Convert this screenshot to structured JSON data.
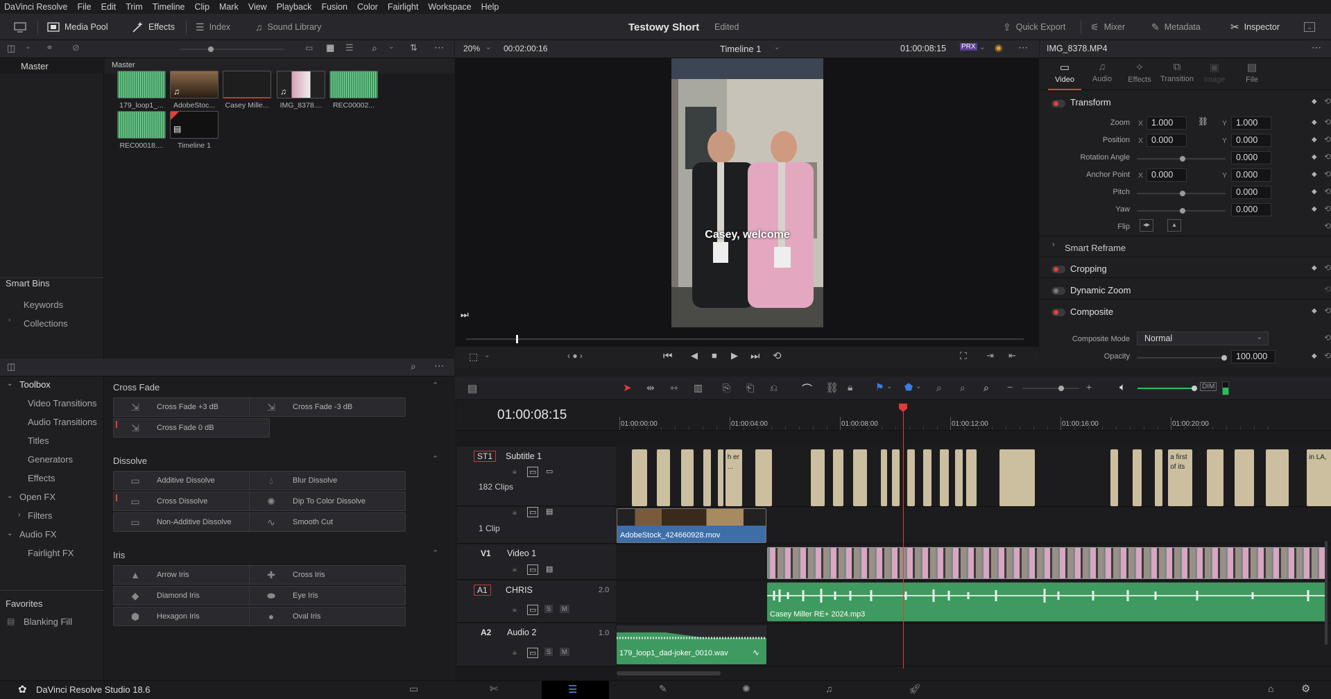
{
  "menu": {
    "items": [
      "DaVinci Resolve",
      "File",
      "Edit",
      "Trim",
      "Timeline",
      "Clip",
      "Mark",
      "View",
      "Playback",
      "Fusion",
      "Color",
      "Fairlight",
      "Workspace",
      "Help"
    ]
  },
  "toolbar": {
    "media_pool": "Media Pool",
    "effects": "Effects",
    "index": "Index",
    "sound_library": "Sound Library",
    "project_title": "Testowy Short",
    "project_status": "Edited",
    "quick_export": "Quick Export",
    "mixer": "Mixer",
    "metadata": "Metadata",
    "inspector": "Inspector"
  },
  "bins": {
    "master": "Master",
    "smart_bins": "Smart Bins",
    "keywords": "Keywords",
    "collections": "Collections"
  },
  "media_pool": {
    "header": "Master",
    "clips": [
      {
        "name": "179_loop1_...",
        "kind": "audio"
      },
      {
        "name": "AdobeStoc...",
        "kind": "video-audio"
      },
      {
        "name": "Casey Mille...",
        "kind": "dark"
      },
      {
        "name": "IMG_8378....",
        "kind": "video-audio"
      },
      {
        "name": "REC00002...",
        "kind": "audio"
      },
      {
        "name": "REC00018....",
        "kind": "audio"
      },
      {
        "name": "Timeline 1",
        "kind": "timeline"
      }
    ]
  },
  "viewer": {
    "zoom": "20%",
    "duration": "00:02:00:16",
    "timeline_name": "Timeline 1",
    "timecode": "01:00:08:15",
    "caption": "Casey, welcome",
    "scrub_progress": 0.09
  },
  "inspector": {
    "clip_name": "IMG_8378.MP4",
    "tabs": [
      "Video",
      "Audio",
      "Effects",
      "Transition",
      "Image",
      "File"
    ],
    "transform": "Transform",
    "zoom_label": "Zoom",
    "zoom_x": "1.000",
    "zoom_y": "1.000",
    "position_label": "Position",
    "position_x": "0.000",
    "position_y": "0.000",
    "rotation_label": "Rotation Angle",
    "rotation": "0.000",
    "anchor_label": "Anchor Point",
    "anchor_x": "0.000",
    "anchor_y": "0.000",
    "pitch_label": "Pitch",
    "pitch": "0.000",
    "yaw_label": "Yaw",
    "yaw": "0.000",
    "flip_label": "Flip",
    "x": "X",
    "y": "Y",
    "smart_reframe": "Smart Reframe",
    "cropping": "Cropping",
    "dynamic_zoom": "Dynamic Zoom",
    "composite": "Composite",
    "composite_mode_label": "Composite Mode",
    "composite_mode": "Normal",
    "opacity_label": "Opacity",
    "opacity": "100.000"
  },
  "toolbox": {
    "tree": [
      {
        "label": "Toolbox",
        "level": 0,
        "chevron": "down"
      },
      {
        "label": "Video Transitions",
        "level": 1
      },
      {
        "label": "Audio Transitions",
        "level": 1
      },
      {
        "label": "Titles",
        "level": 1
      },
      {
        "label": "Generators",
        "level": 1
      },
      {
        "label": "Effects",
        "level": 1
      },
      {
        "label": "Open FX",
        "level": 0,
        "chevron": "down"
      },
      {
        "label": "Filters",
        "level": 1,
        "chevron": "right"
      },
      {
        "label": "Audio FX",
        "level": 0,
        "chevron": "down"
      },
      {
        "label": "Fairlight FX",
        "level": 1
      }
    ],
    "favorites": "Favorites",
    "favorite_item": "Blanking Fill"
  },
  "effects_library": {
    "categories": [
      {
        "name": "Cross Fade",
        "items": [
          "Cross Fade +3 dB",
          "Cross Fade -3 dB",
          "Cross Fade 0 dB"
        ]
      },
      {
        "name": "Dissolve",
        "items": [
          "Additive Dissolve",
          "Blur Dissolve",
          "Cross Dissolve",
          "Dip To Color Dissolve",
          "Non-Additive Dissolve",
          "Smooth Cut"
        ]
      },
      {
        "name": "Iris",
        "items": [
          "Arrow Iris",
          "Cross Iris",
          "Diamond Iris",
          "Eye Iris",
          "Hexagon Iris",
          "Oval Iris"
        ]
      }
    ]
  },
  "timeline": {
    "timecode": "01:00:08:15",
    "ruler": [
      "01:00:00:00",
      "01:00:04:00",
      "01:00:08:00",
      "01:00:12:00",
      "01:00:16:00",
      "01:00:20:00"
    ],
    "tracks": {
      "st1": {
        "id": "ST1",
        "name": "Subtitle 1",
        "clips": "182 Clips"
      },
      "v2": {
        "clips": "1 Clip",
        "clip_name": "AdobeStock_424660928.mov"
      },
      "v1": {
        "id": "V1",
        "name": "Video 1"
      },
      "a1": {
        "id": "A1",
        "name": "CHRIS",
        "channels": "2.0",
        "clip_name": "Casey Miller RE+ 2024.mp3"
      },
      "a2": {
        "id": "A2",
        "name": "Audio 2",
        "channels": "1.0",
        "clip_name": "179_loop1_dad-joker_0010.wav"
      }
    },
    "subtitles": [
      {
        "text": ""
      },
      {
        "text": ""
      },
      {
        "text": ""
      },
      {
        "text": ""
      },
      {
        "text": ""
      },
      {
        "text": "h er ..."
      },
      {
        "text": ""
      },
      {
        "text": ""
      },
      {
        "text": ""
      },
      {
        "text": ""
      },
      {
        "text": ""
      },
      {
        "text": ""
      },
      {
        "text": ""
      },
      {
        "text": ""
      },
      {
        "text": ""
      },
      {
        "text": ""
      },
      {
        "text": ""
      },
      {
        "text": ""
      },
      {
        "text": ""
      },
      {
        "text": ""
      },
      {
        "text": ""
      },
      {
        "text": ""
      },
      {
        "text": "a first of its"
      },
      {
        "text": ""
      },
      {
        "text": ""
      },
      {
        "text": ""
      },
      {
        "text": "in LA,"
      }
    ],
    "track_buttons": {
      "solo": "S",
      "mute": "M"
    },
    "dim": "DIM"
  },
  "status": {
    "app_name": "DaVinci Resolve Studio 18.6"
  },
  "colors": {
    "accent": "#e2403a",
    "subtitle": "#cbbf9f",
    "audio": "#3e9a5f",
    "video_clip": "#3d6ea8"
  }
}
